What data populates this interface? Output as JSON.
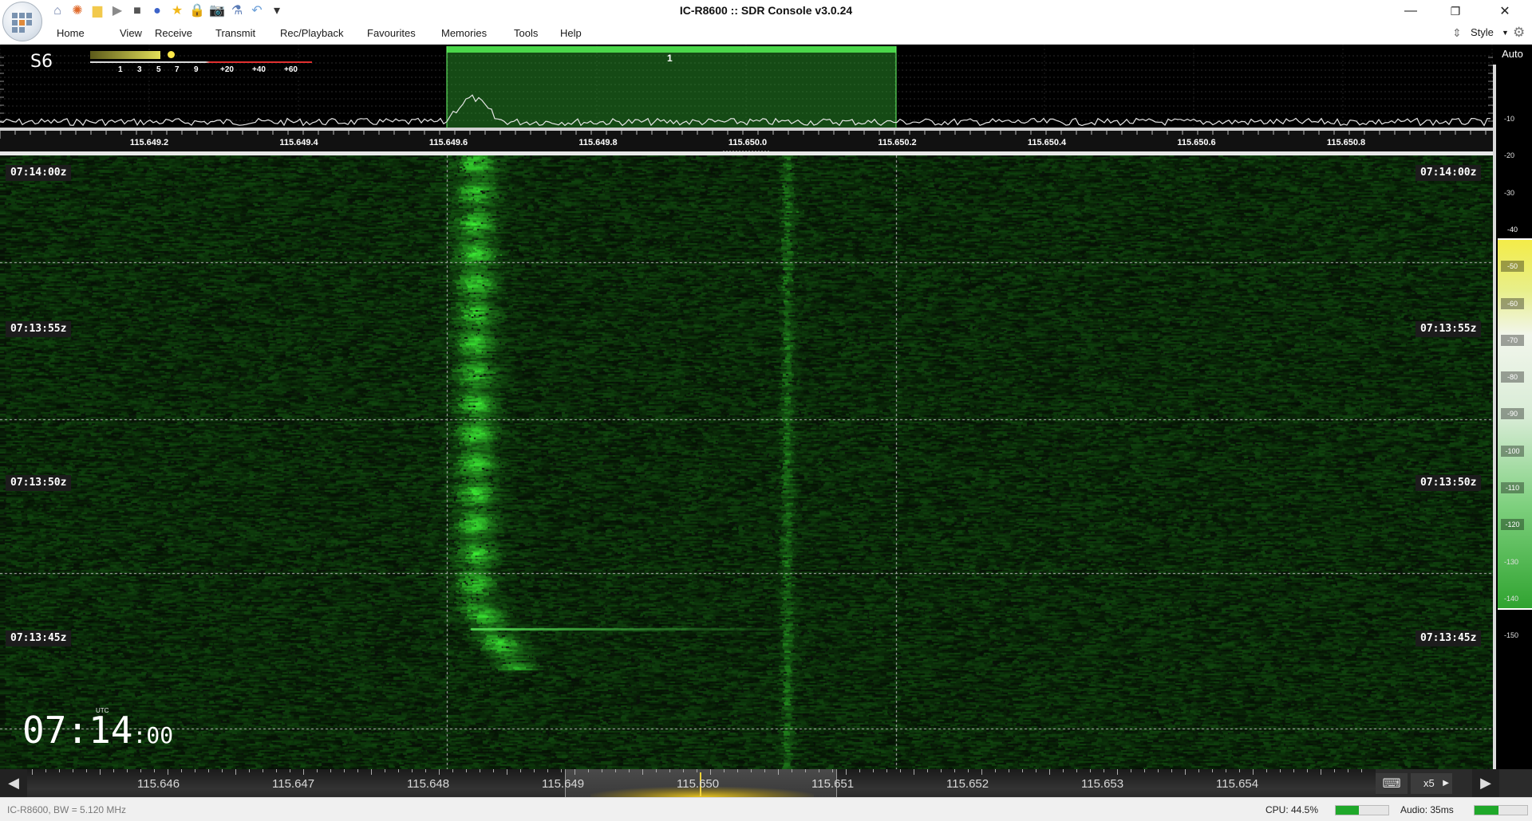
{
  "window": {
    "title": "IC-R8600 :: SDR Console v3.0.24"
  },
  "quick_access": [
    {
      "name": "home-icon",
      "glyph": "⌂",
      "color": "#6b7ea8"
    },
    {
      "name": "lifebuoy-icon",
      "glyph": "✺",
      "color": "#e06a2b"
    },
    {
      "name": "folder-icon",
      "glyph": "▆",
      "color": "#f2c94c"
    },
    {
      "name": "play-icon",
      "glyph": "▶",
      "color": "#8a8a8a"
    },
    {
      "name": "stop-icon",
      "glyph": "■",
      "color": "#555555"
    },
    {
      "name": "record-icon",
      "glyph": "●",
      "color": "#3c63c9"
    },
    {
      "name": "star-icon",
      "glyph": "★",
      "color": "#f2b81a"
    },
    {
      "name": "lock-icon",
      "glyph": "🔒",
      "color": "#e0b020"
    },
    {
      "name": "camera-icon",
      "glyph": "📷",
      "color": "#444444"
    },
    {
      "name": "flask-icon",
      "glyph": "⚗",
      "color": "#5a7bb5"
    },
    {
      "name": "undo-icon",
      "glyph": "↶",
      "color": "#6a9ed8"
    },
    {
      "name": "dropdown-icon",
      "glyph": "▾",
      "color": "#333333"
    }
  ],
  "menu": [
    "Home",
    "View",
    "Receive",
    "Transmit",
    "Rec/Playback",
    "Favourites",
    "Memories",
    "Tools",
    "Help"
  ],
  "toolbar_right": {
    "style_label": "Style"
  },
  "smeter": {
    "reading": "S6",
    "scale": [
      "1",
      "3",
      "5",
      "7",
      "9",
      "+20",
      "+40",
      "+60"
    ],
    "level": 0.42
  },
  "spectrum": {
    "freq_labels": [
      "115.649.2",
      "115.649.4",
      "115.649.6",
      "115.649.8",
      "115.650.0",
      "115.650.2",
      "115.650.4",
      "115.650.6",
      "115.650.8"
    ],
    "vfo_number": "1",
    "auto_label": "Auto"
  },
  "dbm_scale": [
    "-10",
    "-20",
    "-30",
    "-40",
    "-50",
    "-60",
    "-70",
    "-80",
    "-90",
    "-100",
    "-110",
    "-120",
    "-130",
    "-140",
    "-150"
  ],
  "waterfall": {
    "timestamps": [
      "07:14:00z",
      "07:13:55z",
      "07:13:50z",
      "07:13:45z"
    ],
    "clock": {
      "utc_label": "UTC",
      "hhmm": "07:14",
      "ss": ":00"
    }
  },
  "bottom": {
    "freq_labels": [
      "115.646",
      "115.647",
      "115.648",
      "115.649",
      "115.650",
      "115.651",
      "115.652",
      "115.653",
      "115.654"
    ],
    "zoom": "x5"
  },
  "status": {
    "device": "IC-R8600, BW = 5.120 MHz",
    "cpu": "CPU: 44.5%",
    "cpu_level": 0.445,
    "audio": "Audio: 35ms",
    "audio_level": 0.45
  },
  "colors": {
    "signal": "#3fd23f",
    "vfo": "#2fa32f",
    "accent_yellow": "#e8d83a"
  }
}
